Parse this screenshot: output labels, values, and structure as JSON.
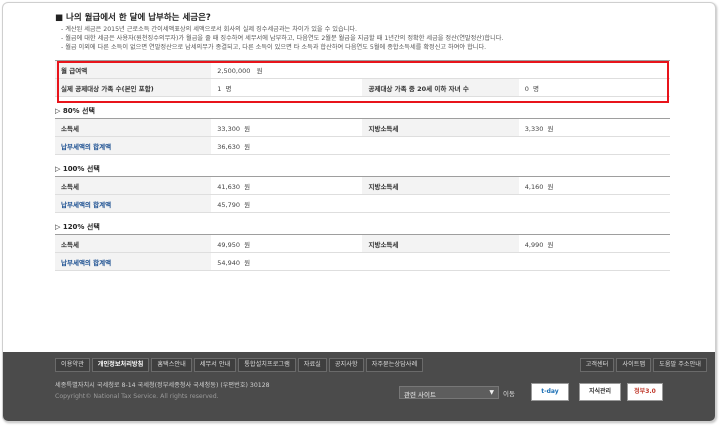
{
  "question_title": "나의 월급에서 한 달에 납부하는 세금은?",
  "notes": [
    "- 계산된 세금은 2015년 근로소득 간이세액표상의 세액으로서 회사의 실제 징수세금과는 차이가 있을 수 있습니다.",
    "- 월급에 대한 세금은 사용자(원천징수의무자)가 월급을 줄 때 징수하여 세무서에 납부하고, 다음연도 2월분 월급을 지급할 때 1년간의 정확한 세금을 정산(연말정산)합니다.",
    "- 월급 이외에 다른 소득이 없으면 연말정산으로 납세의무가 종결되고, 다른 소득이 있으면 타 소득과 합산하여 다음연도 5월에 종합소득세를 확정신고 하여야 합니다."
  ],
  "input": {
    "salary_label": "월 급여액",
    "salary_value": "2,500,000",
    "unit_won": "원",
    "family_label": "실제 공제대상 가족 수(본인 포함)",
    "family_value": "1",
    "unit_person": "명",
    "children_label": "공제대상 가족 중 20세 이하 자녀 수",
    "children_value": "0"
  },
  "sections": [
    {
      "title": "▷ 80% 선택",
      "income_tax_label": "소득세",
      "income_tax": "33,300",
      "local_tax_label": "지방소득세",
      "local_tax": "3,330",
      "total_label": "납부세액의 합계액",
      "total": "36,630"
    },
    {
      "title": "▷ 100% 선택",
      "income_tax_label": "소득세",
      "income_tax": "41,630",
      "local_tax_label": "지방소득세",
      "local_tax": "4,160",
      "total_label": "납부세액의 합계액",
      "total": "45,790"
    },
    {
      "title": "▷ 120% 선택",
      "income_tax_label": "소득세",
      "income_tax": "49,950",
      "local_tax_label": "지방소득세",
      "local_tax": "4,990",
      "total_label": "납부세액의 합계액",
      "total": "54,940"
    }
  ],
  "footer": {
    "nav": [
      "이용약관",
      "개인정보처리방침",
      "홈택스안내",
      "세무서 안내",
      "통합설치프로그램",
      "자료실",
      "공지사항",
      "자주묻는상담사례"
    ],
    "nav_right": [
      "고객센터",
      "사이트맵",
      "도움말 주소안내"
    ],
    "address": "세종특별자치시 국세청로 8-14 국세청(정부세종청사 국세청동) (우편번호) 30128",
    "copyright": "Copyright© National Tax Service. All rights reserved.",
    "related_sites": "관련 사이트",
    "go_label": "이동",
    "badges": [
      "t-day",
      "지식관리",
      "정부3.0"
    ]
  }
}
